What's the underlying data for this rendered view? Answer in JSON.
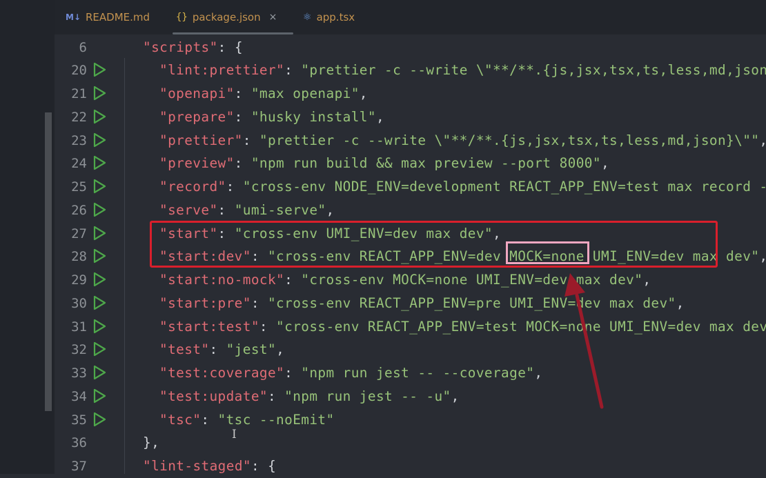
{
  "tabs": [
    {
      "icon": "M↓",
      "label": "README.md"
    },
    {
      "icon": "{}",
      "label": "package.json",
      "close": "×"
    },
    {
      "icon": "⚛",
      "label": "app.tsx"
    }
  ],
  "line_numbers": [
    "6",
    "20",
    "21",
    "22",
    "23",
    "24",
    "25",
    "26",
    "27",
    "28",
    "29",
    "30",
    "31",
    "32",
    "33",
    "34",
    "35",
    "36",
    "37"
  ],
  "lines": {
    "l6": {
      "key": "\"scripts\"",
      "rest": ": {"
    },
    "l20": {
      "key": "\"lint:prettier\"",
      "val": "\"prettier -c --write \\\"**/**.{js,jsx,tsx,ts,less,md,json}"
    },
    "l21": {
      "key": "\"openapi\"",
      "val": "\"max openapi\"",
      "end": ","
    },
    "l22": {
      "key": "\"prepare\"",
      "val": "\"husky install\"",
      "end": ","
    },
    "l23": {
      "key": "\"prettier\"",
      "val": "\"prettier -c --write \\\"**/**.{js,jsx,tsx,ts,less,md,json}\\\"\"",
      "end": ","
    },
    "l24": {
      "key": "\"preview\"",
      "val": "\"npm run build && max preview --port 8000\"",
      "end": ","
    },
    "l25": {
      "key": "\"record\"",
      "val": "\"cross-env NODE_ENV=development REACT_APP_ENV=test max record -"
    },
    "l26": {
      "key": "\"serve\"",
      "val": "\"umi-serve\"",
      "end": ","
    },
    "l27": {
      "key": "\"start\"",
      "val": "\"cross-env UMI_ENV=dev max dev\"",
      "end": ","
    },
    "l28": {
      "key": "\"start:dev\"",
      "val": "\"cross-env REACT_APP_ENV=dev MOCK=none UMI_ENV=dev max dev\"",
      "end": ","
    },
    "l29": {
      "key": "\"start:no-mock\"",
      "val": "\"cross-env MOCK=none UMI_ENV=dev max dev\"",
      "end": ","
    },
    "l30": {
      "key": "\"start:pre\"",
      "val": "\"cross-env REACT_APP_ENV=pre UMI_ENV=dev max dev\"",
      "end": ","
    },
    "l31": {
      "key": "\"start:test\"",
      "val": "\"cross-env REACT_APP_ENV=test MOCK=none UMI_ENV=dev max dev"
    },
    "l32": {
      "key": "\"test\"",
      "val": "\"jest\"",
      "end": ","
    },
    "l33": {
      "key": "\"test:coverage\"",
      "val": "\"npm run jest -- --coverage\"",
      "end": ","
    },
    "l34": {
      "key": "\"test:update\"",
      "val": "\"npm run jest -- -u\"",
      "end": ","
    },
    "l35": {
      "key": "\"tsc\"",
      "val": "\"tsc --noEmit\""
    },
    "l36": {
      "rest": "},"
    },
    "l37": {
      "key": "\"lint-staged\"",
      "rest": ": {"
    }
  },
  "colors": {
    "key": "#e06c75",
    "string": "#98c379",
    "highlight_box": "#d91f2c",
    "highlight_inner": "#f0a7c1",
    "arrow": "#9b1b2a",
    "run_icon": "#4ea84a"
  }
}
